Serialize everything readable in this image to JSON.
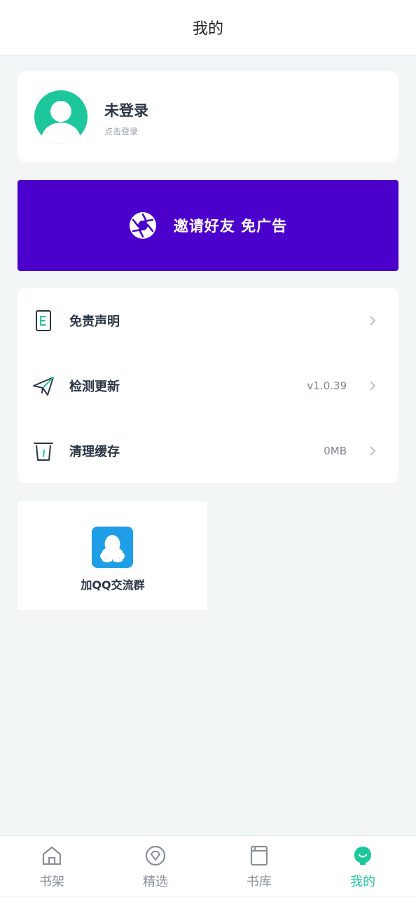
{
  "header": {
    "title": "我的"
  },
  "profile": {
    "name": "未登录",
    "subtitle": "点击登录",
    "avatar_color": "#1dc79c"
  },
  "invite": {
    "label": "邀请好友 免广告",
    "background": "#4c00cc",
    "icon": "aperture-icon"
  },
  "menu": {
    "items": [
      {
        "label": "免责声明",
        "value": "",
        "icon": "document-icon"
      },
      {
        "label": "检测更新",
        "value": "v1.0.39",
        "icon": "paper-plane-icon"
      },
      {
        "label": "清理缓存",
        "value": "0MB",
        "icon": "trash-icon"
      }
    ]
  },
  "qq_group": {
    "label": "加QQ交流群",
    "icon": "qq-icon",
    "icon_color": "#1d9ee6"
  },
  "tabbar": {
    "accent": "#1dc79c",
    "tabs": [
      {
        "label": "书架",
        "icon": "home-icon"
      },
      {
        "label": "精选",
        "icon": "diamond-icon"
      },
      {
        "label": "书库",
        "icon": "book-icon"
      },
      {
        "label": "我的",
        "icon": "profile-icon",
        "active": true
      }
    ]
  }
}
